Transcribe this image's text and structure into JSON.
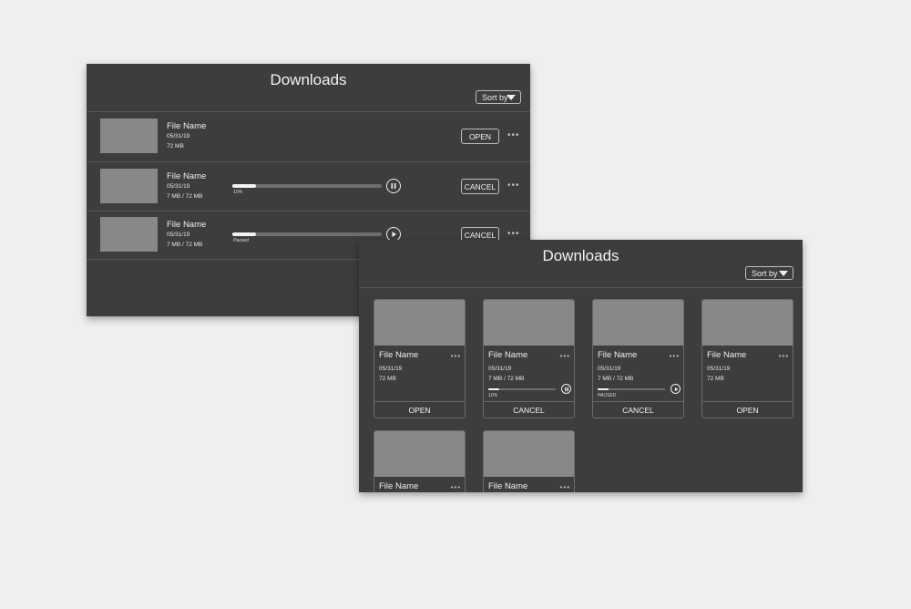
{
  "list_view": {
    "title": "Downloads",
    "sort_label": "Sort by",
    "items": [
      {
        "name": "File Name",
        "date": "05/31/19",
        "size": "72 MB",
        "action": "OPEN",
        "progress": null,
        "progress_label": "",
        "control": "none"
      },
      {
        "name": "File Name",
        "date": "05/31/19",
        "size": "7 MB / 72 MB",
        "action": "CANCEL",
        "progress": 0.16,
        "progress_label": "10%",
        "control": "pause-icon"
      },
      {
        "name": "File Name",
        "date": "05/31/19",
        "size": "7 MB / 72 MB",
        "action": "CANCEL",
        "progress": 0.16,
        "progress_label": "Paused",
        "control": "play-icon"
      }
    ]
  },
  "grid_view": {
    "title": "Downloads",
    "sort_label": "Sort by",
    "items": [
      {
        "name": "File Name",
        "date": "05/31/19",
        "size": "72 MB",
        "action": "OPEN",
        "progress": null,
        "progress_label": "",
        "control": "none"
      },
      {
        "name": "File Name",
        "date": "05/31/19",
        "size": "7 MB / 72 MB",
        "action": "CANCEL",
        "progress": 0.16,
        "progress_label": "10%",
        "control": "pause-icon"
      },
      {
        "name": "File Name",
        "date": "05/31/19",
        "size": "7 MB / 72 MB",
        "action": "CANCEL",
        "progress": 0.16,
        "progress_label": "PAUSED",
        "control": "play-icon"
      },
      {
        "name": "File Name",
        "date": "05/31/19",
        "size": "72 MB",
        "action": "OPEN",
        "progress": null,
        "progress_label": "",
        "control": "none"
      },
      {
        "name": "File Name"
      },
      {
        "name": "File Name"
      }
    ]
  },
  "icons": {
    "more": "more-dots-icon",
    "sort": "caret-down-icon"
  },
  "colors": {
    "panel_bg": "#3d3d3d",
    "thumbnail": "#8a8787",
    "page_bg": "#efefef"
  }
}
